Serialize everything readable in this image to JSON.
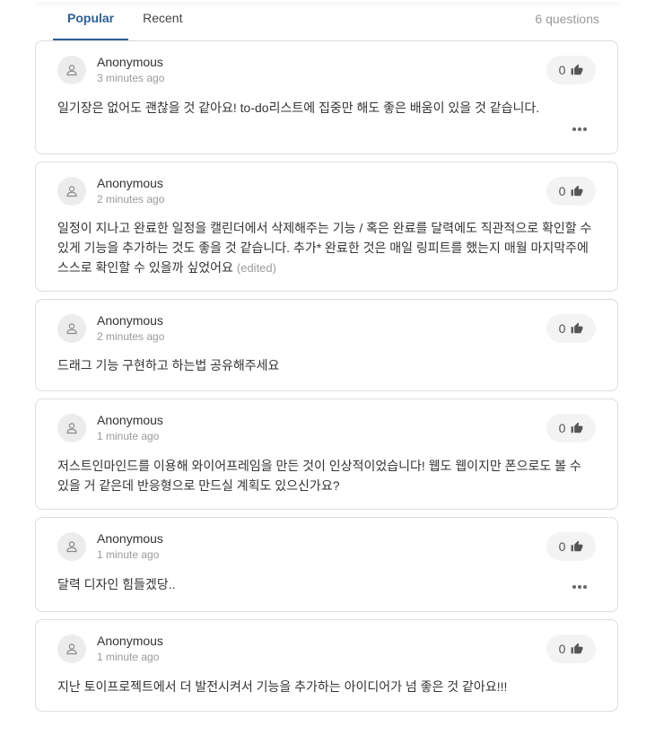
{
  "tabs": {
    "popular": "Popular",
    "recent": "Recent",
    "count": "6 questions"
  },
  "questions": [
    {
      "author": "Anonymous",
      "time": "3 minutes ago",
      "likes": "0",
      "text": "일기장은 없어도 괜찮을 것 같아요! to-do리스트에 집중만 해도 좋은 배움이 있을 것 같습니다.",
      "edited": ""
    },
    {
      "author": "Anonymous",
      "time": "2 minutes ago",
      "likes": "0",
      "text": "일정이 지나고 완료한 일정을 캘린더에서 삭제해주는 기능 / 혹은 완료를 달력에도 직관적으로 확인할 수 있게 기능을 추가하는 것도 좋을 것 같습니다. 추가* 완료한 것은 매일 링피트를 했는지 매월 마지막주에 스스로 확인할 수 있을까 싶었어요",
      "edited": "(edited)"
    },
    {
      "author": "Anonymous",
      "time": "2 minutes ago",
      "likes": "0",
      "text": "드래그 기능 구현하고 하는법 공유해주세요",
      "edited": ""
    },
    {
      "author": "Anonymous",
      "time": "1 minute ago",
      "likes": "0",
      "text": "저스트인마인드를 이용해 와이어프레임을 만든 것이 인상적이었습니다! 웹도 웹이지만 폰으로도 볼 수 있을 거 같은데 반응형으로 만드실 계획도 있으신가요?",
      "edited": ""
    },
    {
      "author": "Anonymous",
      "time": "1 minute ago",
      "likes": "0",
      "text": "달력 디자인 힘들겠당..",
      "edited": ""
    },
    {
      "author": "Anonymous",
      "time": "1 minute ago",
      "likes": "0",
      "text": "지난 토이프로젝트에서 더 발전시켜서 기능을 추가하는 아이디어가 넘 좋은 것 같아요!!!",
      "edited": ""
    }
  ],
  "icons": {
    "avatar": "user-icon",
    "like": "thumbs-up-icon",
    "more": "more-horizontal-icon"
  }
}
